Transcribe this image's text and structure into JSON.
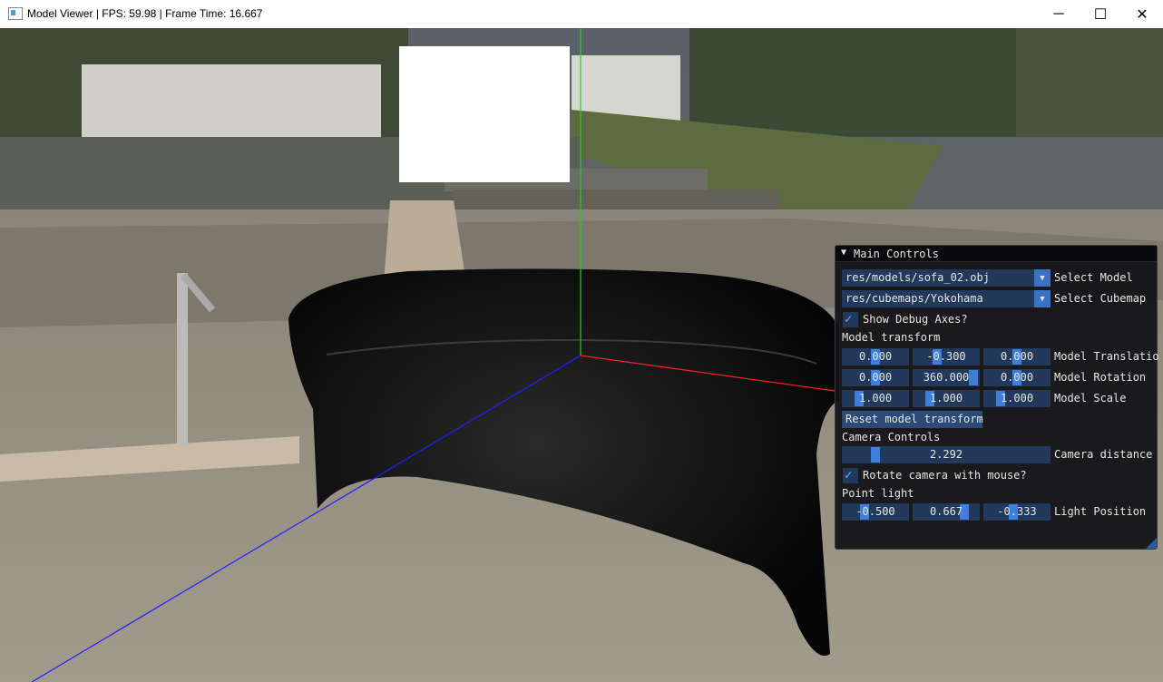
{
  "window": {
    "title": "Model Viewer | FPS: 59.98 | Frame Time: 16.667"
  },
  "panel": {
    "title": "Main Controls",
    "model_combo": {
      "value": "res/models/sofa_02.obj",
      "label": "Select Model"
    },
    "cubemap_combo": {
      "value": "res/cubemaps/Yokohama",
      "label": "Select Cubemap"
    },
    "debug_axes": {
      "label": "Show Debug Axes?",
      "checked": true
    },
    "model_transform_header": "Model transform",
    "translation": {
      "values": [
        "0.000",
        "-0.300",
        "0.000"
      ],
      "label": "Model Translatio"
    },
    "rotation": {
      "values": [
        "0.000",
        "360.000",
        "0.000"
      ],
      "label": "Model Rotation"
    },
    "scale": {
      "values": [
        "1.000",
        "1.000",
        "1.000"
      ],
      "label": "Model Scale"
    },
    "reset_button": "Reset model transform",
    "camera_header": "Camera Controls",
    "camera_distance": {
      "value": "2.292",
      "label": "Camera distance"
    },
    "rotate_camera": {
      "label": "Rotate camera with mouse?",
      "checked": true
    },
    "point_light_header": "Point light",
    "light_position": {
      "values": [
        "-0.500",
        "0.667",
        "-0.333"
      ],
      "label": "Light Position"
    }
  },
  "colors": {
    "axis_x": "#ff2020",
    "axis_y": "#20d020",
    "axis_z": "#2020ff",
    "panel_accent": "#3f7fdb"
  }
}
